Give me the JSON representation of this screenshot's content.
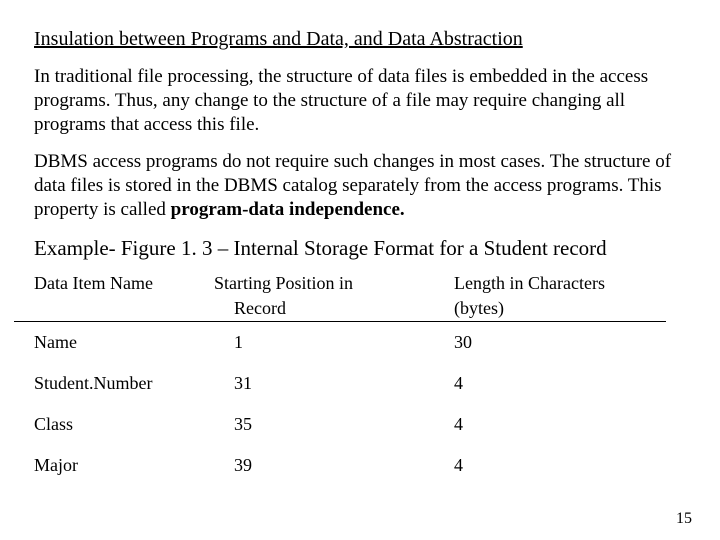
{
  "heading": "Insulation between Programs and Data, and Data Abstraction",
  "para1": "In traditional file processing, the structure of data files is embedded in the access programs.  Thus, any change to the structure of a file may require changing all programs that access this file.",
  "para2_a": "DBMS access programs do not require such changes in most cases.  The structure of data files is stored in the DBMS catalog separately from the access programs.  This property is called ",
  "para2_b": "program-data independence.",
  "example_line": "Example- Figure 1. 3 – Internal Storage Format for a Student record",
  "table": {
    "header": {
      "name": "Data Item Name",
      "start": "Starting Position in",
      "len": "Length in Characters"
    },
    "subheader": {
      "record": "Record",
      "bytes": "(bytes)"
    },
    "rows": [
      {
        "name": "Name",
        "start": "1",
        "len": "30"
      },
      {
        "name": "Student.Number",
        "start": "31",
        "len": "4"
      },
      {
        "name": "Class",
        "start": "35",
        "len": "4"
      },
      {
        "name": "Major",
        "start": "39",
        "len": "4"
      }
    ]
  },
  "page_number": "15"
}
